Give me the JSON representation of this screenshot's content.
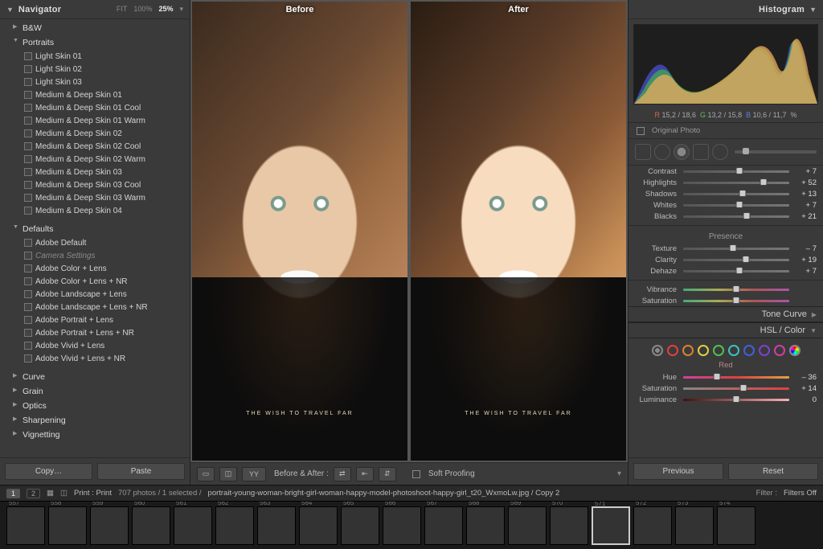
{
  "navigator": {
    "title": "Navigator",
    "zoom": {
      "fit": "FIT",
      "p100": "100%",
      "p25": "25%"
    }
  },
  "presets": {
    "bw": "B&W",
    "portraits": "Portraits",
    "portrait_items": [
      "Light Skin 01",
      "Light Skin 02",
      "Light Skin 03",
      "Medium & Deep Skin 01",
      "Medium & Deep Skin 01 Cool",
      "Medium & Deep Skin 01 Warm",
      "Medium & Deep Skin 02",
      "Medium & Deep Skin 02 Cool",
      "Medium & Deep Skin 02 Warm",
      "Medium & Deep Skin 03",
      "Medium & Deep Skin 03 Cool",
      "Medium & Deep Skin 03 Warm",
      "Medium & Deep Skin 04"
    ],
    "defaults": "Defaults",
    "default_items": [
      "Adobe Default",
      "Camera Settings",
      "Adobe Color + Lens",
      "Adobe Color + Lens + NR",
      "Adobe Landscape + Lens",
      "Adobe Landscape + Lens + NR",
      "Adobe Portrait + Lens",
      "Adobe Portrait + Lens + NR",
      "Adobe Vivid + Lens",
      "Adobe Vivid + Lens + NR"
    ],
    "closed_groups": [
      "Curve",
      "Grain",
      "Optics",
      "Sharpening",
      "Vignetting"
    ]
  },
  "left_footer": {
    "copy": "Copy…",
    "paste": "Paste"
  },
  "compare": {
    "before": "Before",
    "after": "After"
  },
  "center_toolbar": {
    "label": "Before & After :",
    "soft": "Soft Proofing"
  },
  "histogram": {
    "title": "Histogram",
    "rgb": {
      "r": "15,2 / 18,6",
      "g": "13,2 / 15,8",
      "b": "10,6 / 11,7",
      "pct": "%"
    },
    "original": "Original Photo"
  },
  "tone": {
    "contrast": "Contrast",
    "contrast_v": "+ 7",
    "highlights": "Highlights",
    "highlights_v": "+ 52",
    "shadows": "Shadows",
    "shadows_v": "+ 13",
    "whites": "Whites",
    "whites_v": "+ 7",
    "blacks": "Blacks",
    "blacks_v": "+ 21",
    "presence": "Presence",
    "texture": "Texture",
    "texture_v": "– 7",
    "clarity": "Clarity",
    "clarity_v": "+ 19",
    "dehaze": "Dehaze",
    "dehaze_v": "+ 7",
    "vibrance": "Vibrance",
    "vibrance_v": "",
    "saturation": "Saturation",
    "saturation_v": ""
  },
  "sections": {
    "tonecurve": "Tone Curve",
    "hsl": "HSL / Color"
  },
  "hsl": {
    "red": "Red",
    "hue": "Hue",
    "hue_v": "– 36",
    "sat": "Saturation",
    "sat_v": "+ 14",
    "lum": "Luminance",
    "lum_v": "0"
  },
  "right_footer": {
    "prev": "Previous",
    "reset": "Reset"
  },
  "pathbar": {
    "print": "Print : Print",
    "count": "707 photos / 1 selected /",
    "path": "portrait-young-woman-bright-girl-woman-happy-model-photoshoot-happy-girl_t20_WxmoLw.jpg / Copy 2",
    "filter": "Filter :",
    "filters_off": "Filters Off"
  },
  "film_numbers": [
    "557",
    "558",
    "559",
    "560",
    "561",
    "562",
    "563",
    "564",
    "565",
    "566",
    "567",
    "568",
    "569",
    "570",
    "571",
    "572",
    "573",
    "574"
  ]
}
